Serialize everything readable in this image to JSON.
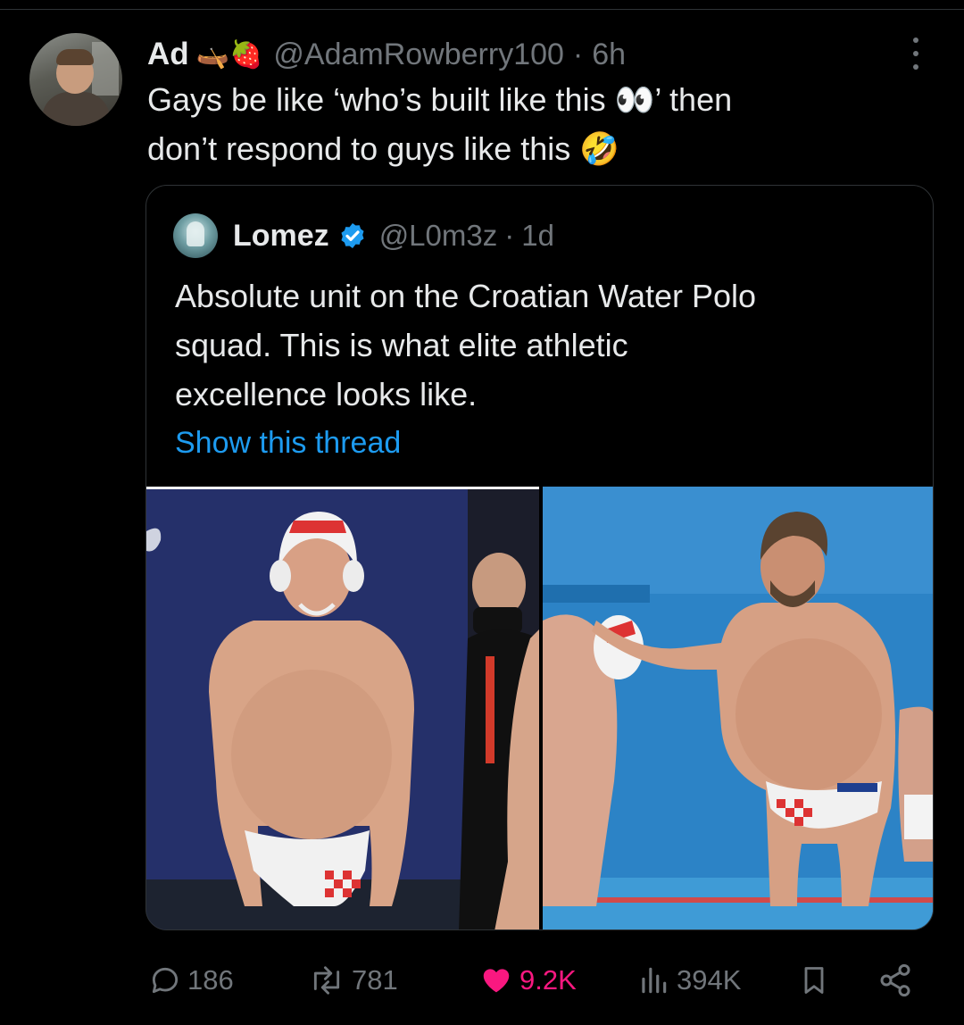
{
  "tweet": {
    "author_name": "Ad",
    "author_emojis": "🛶🍓",
    "handle": "@AdamRowberry100",
    "separator": "·",
    "time": "6h",
    "text_line1": "Gays be like ‘who’s built like this 👀’ then",
    "text_line2": "don’t respond to guys like this 🤣"
  },
  "quoted": {
    "author_name": "Lomez",
    "handle": "@L0m3z",
    "separator": "·",
    "time": "1d",
    "text_line1": "Absolute unit on the Croatian Water Polo",
    "text_line2": "squad. This is what elite athletic",
    "text_line3": "excellence looks like.",
    "link": "Show this thread"
  },
  "actions": {
    "replies": "186",
    "reposts": "781",
    "likes": "9.2K",
    "views": "394K"
  },
  "icons": {
    "more": "more-vertical-icon",
    "reply": "reply-icon",
    "repost": "repost-icon",
    "like": "heart-filled-icon",
    "views": "views-bar-icon",
    "bookmark": "bookmark-icon",
    "share": "share-icon",
    "verified": "verified-badge-icon"
  },
  "colors": {
    "background": "#000000",
    "text": "#e7e9ea",
    "muted": "#71767b",
    "link": "#1d9bf0",
    "like": "#f91880",
    "border": "#2f3336"
  }
}
